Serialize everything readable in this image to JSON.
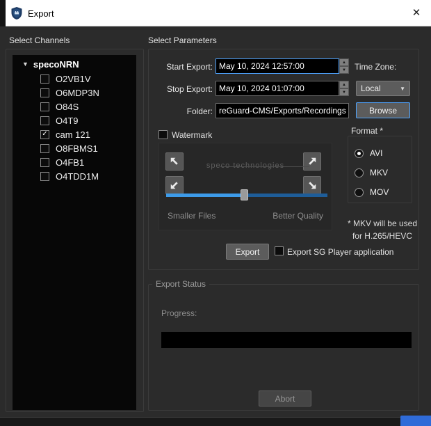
{
  "window": {
    "title": "Export"
  },
  "icons": {
    "close": "✕",
    "tree_expander": "▼",
    "check": "✓",
    "chevron_down": "▼",
    "spinner_up": "▲",
    "spinner_down": "▼"
  },
  "channels": {
    "section_label": "Select Channels",
    "root": "specoNRN",
    "items": [
      {
        "label": "O2VB1V",
        "checked": false
      },
      {
        "label": "O6MDP3N",
        "checked": false
      },
      {
        "label": "O84S",
        "checked": false
      },
      {
        "label": "O4T9",
        "checked": false
      },
      {
        "label": "cam 121",
        "checked": true
      },
      {
        "label": "O8FBMS1",
        "checked": false
      },
      {
        "label": "O4FB1",
        "checked": false
      },
      {
        "label": "O4TDD1M",
        "checked": false
      }
    ]
  },
  "parameters": {
    "section_label": "Select Parameters",
    "start": {
      "label": "Start Export:",
      "value": "May 10, 2024 12:57:00"
    },
    "stop": {
      "label": "Stop Export:",
      "value": "May 10, 2024 01:07:00"
    },
    "timezone": {
      "label": "Time Zone:",
      "value": "Local"
    },
    "folder": {
      "label": "Folder:",
      "value": "reGuard-CMS/Exports/Recordings"
    },
    "browse_label": "Browse",
    "watermark": {
      "label": "Watermark",
      "preview_text": "speco technologies",
      "slider_left": "Smaller Files",
      "slider_right": "Better Quality"
    },
    "format": {
      "label": "Format *",
      "options": [
        "AVI",
        "MKV",
        "MOV"
      ],
      "selected": "AVI",
      "note_line1": "* MKV will be used",
      "note_line2": "for H.265/HEVC"
    },
    "export_label": "Export",
    "sg_player_label": "Export SG Player application"
  },
  "status": {
    "section_label": "Export Status",
    "progress_label": "Progress:",
    "abort_label": "Abort"
  }
}
